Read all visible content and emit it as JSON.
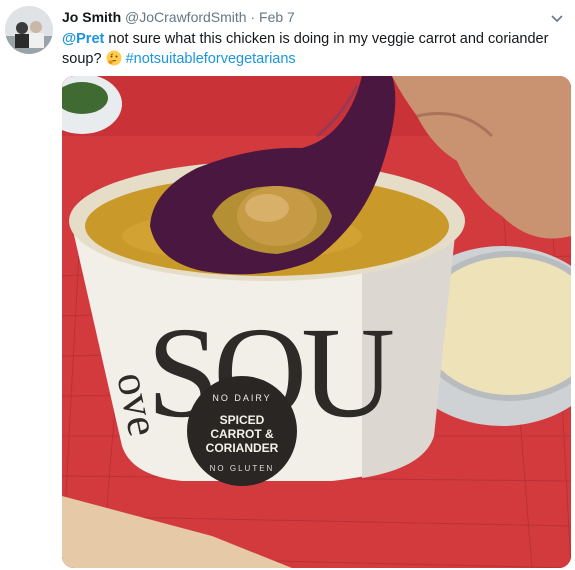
{
  "tweet": {
    "author_name": "Jo Smith",
    "author_handle": "@JoCrawfordSmith",
    "separator": "·",
    "timestamp": "Feb 7",
    "mention": "@Pret",
    "text": " not sure what this chicken is doing in my veggie carrot and coriander soup? ",
    "emoji": "thinking-face-emoji",
    "hashtag": "#notsuitableforvegetarians"
  },
  "media": {
    "description_icon": "soup-photo",
    "cup_text_large": "SOU",
    "cup_text_side": "ove",
    "label_top": "NO DAIRY",
    "label_line1": "SPICED",
    "label_line2": "CARROT &",
    "label_line3": "CORIANDER",
    "label_bottom": "NO GLUTEN"
  },
  "colors": {
    "link": "#1b95e0",
    "text": "#14171a",
    "meta": "#657786",
    "placemat": "#d9363b",
    "soup": "#c99a2a",
    "spoon": "#4a1740"
  }
}
